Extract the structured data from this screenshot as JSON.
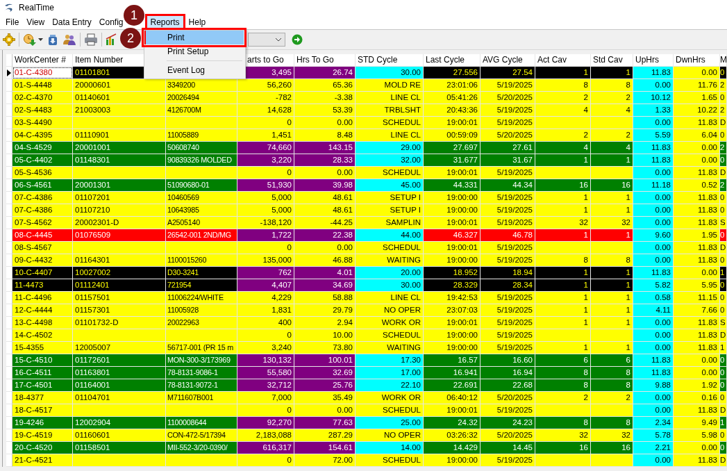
{
  "window": {
    "title": "RealTime"
  },
  "menu_bar": [
    {
      "label": "File",
      "selected": false,
      "annotated": false
    },
    {
      "label": "View",
      "selected": false,
      "annotated": false
    },
    {
      "label": "Data Entry",
      "selected": false,
      "annotated": false
    },
    {
      "label": "Config",
      "selected": false,
      "annotated": false
    },
    {
      "label": "Reports",
      "selected": true,
      "annotated": true
    },
    {
      "label": "Help",
      "selected": false,
      "annotated": false
    }
  ],
  "dropdown_menu": [
    {
      "kind": "item",
      "label": "Print",
      "selected": true,
      "annotated": true
    },
    {
      "kind": "item",
      "label": "Print Setup",
      "selected": false,
      "annotated": false
    },
    {
      "kind": "separator"
    },
    {
      "kind": "item",
      "label": "Event Log",
      "selected": false,
      "annotated": false
    }
  ],
  "callouts": [
    {
      "number": "1"
    },
    {
      "number": "2"
    }
  ],
  "table": {
    "columns": [
      "WorkCenter #",
      "Item Number",
      null,
      "arts to Go",
      "Hrs To Go",
      "STD Cycle",
      "Last Cycle",
      "AVG Cycle",
      "Act Cav",
      "Std Cav",
      "UpHrs",
      "DwnHrs",
      "M"
    ],
    "rows": [
      {
        "color": "#000000",
        "selected": true,
        "cells": [
          "01-C-4380",
          "01101801",
          null,
          "3,495",
          "26.74",
          "30.00",
          "27.556",
          "27.54",
          "1",
          "1",
          "11.83",
          "0.00",
          "0"
        ]
      },
      {
        "color": "#ffff00",
        "selected": false,
        "cells": [
          "01-S-4448",
          "20000601",
          "3349200",
          "56,260",
          "65.36",
          "MOLD RE",
          "23:01:06",
          "5/19/2025",
          "8",
          "8",
          "0.00",
          "11.76",
          "2"
        ]
      },
      {
        "color": "#ffff00",
        "selected": false,
        "cells": [
          "02-C-4370",
          "01140601",
          "20026494",
          "-782",
          "-3.38",
          "LINE CL",
          "05:41:26",
          "5/20/2025",
          "2",
          "2",
          "10.12",
          "1.65",
          "0"
        ]
      },
      {
        "color": "#ffff00",
        "selected": false,
        "cells": [
          "02-S-4483",
          "21003003",
          "4126700M",
          "14,628",
          "53.39",
          "TRBLSHT",
          "20:43:36",
          "5/19/2025",
          "4",
          "4",
          "1.33",
          "10.22",
          "2"
        ]
      },
      {
        "color": "#ffff00",
        "selected": false,
        "cells": [
          "03-S-4490",
          null,
          null,
          "0",
          "0.00",
          "SCHEDUL",
          "19:00:01",
          "5/19/2025",
          null,
          null,
          "0.00",
          "11.83",
          "D"
        ]
      },
      {
        "color": "#ffff00",
        "selected": false,
        "cells": [
          "04-C-4395",
          "01110901",
          "11005889",
          "1,451",
          "8.48",
          "LINE CL",
          "00:59:09",
          "5/20/2025",
          "2",
          "2",
          "5.59",
          "6.04",
          "0"
        ]
      },
      {
        "color": "#008000",
        "selected": false,
        "cells": [
          "04-S-4529",
          "20001001",
          "50608740",
          "74,660",
          "143.15",
          "29.00",
          "27.697",
          "27.61",
          "4",
          "4",
          "11.83",
          "0.00",
          "2"
        ]
      },
      {
        "color": "#008000",
        "selected": false,
        "cells": [
          "05-C-4402",
          "01148301",
          "90839326 MOLDED",
          "3,220",
          "28.33",
          "32.00",
          "31.677",
          "31.67",
          "1",
          "1",
          "11.83",
          "0.00",
          "0"
        ]
      },
      {
        "color": "#ffff00",
        "selected": false,
        "cells": [
          "05-S-4536",
          null,
          null,
          "0",
          "0.00",
          "SCHEDUL",
          "19:00:01",
          "5/19/2025",
          null,
          null,
          "0.00",
          "11.83",
          "D"
        ]
      },
      {
        "color": "#008000",
        "selected": false,
        "cells": [
          "06-S-4561",
          "20001301",
          "51090680-01",
          "51,930",
          "39.98",
          "45.00",
          "44.331",
          "44.34",
          "16",
          "16",
          "11.18",
          "0.52",
          "2"
        ]
      },
      {
        "color": "#ffff00",
        "selected": false,
        "cells": [
          "07-C-4386",
          "01107201",
          "10460569",
          "5,000",
          "48.61",
          "SETUP I",
          "19:00:00",
          "5/19/2025",
          "1",
          "1",
          "0.00",
          "11.83",
          "0"
        ]
      },
      {
        "color": "#ffff00",
        "selected": false,
        "cells": [
          "07-C-4386",
          "01107210",
          "10643985",
          "5,000",
          "48.61",
          "SETUP I",
          "19:00:00",
          "5/19/2025",
          "1",
          "1",
          "0.00",
          "11.83",
          "0"
        ]
      },
      {
        "color": "#ffff00",
        "selected": false,
        "cells": [
          "07-S-4562",
          "20002301-D",
          "A2505140",
          "-138,120",
          "-44.25",
          "SAMPLIN",
          "19:00:01",
          "5/19/2025",
          "32",
          "32",
          "0.00",
          "11.83",
          "S"
        ]
      },
      {
        "color": "#ff0000",
        "selected": false,
        "cells": [
          "08-C-4445",
          "01076509",
          "26542-001 2ND/MG",
          "1,722",
          "22.38",
          "44.00",
          "46.327",
          "46.78",
          "1",
          "1",
          "9.60",
          "1.95",
          "0"
        ]
      },
      {
        "color": "#ffff00",
        "selected": false,
        "cells": [
          "08-S-4567",
          null,
          null,
          "0",
          "0.00",
          "SCHEDUL",
          "19:00:01",
          "5/19/2025",
          null,
          null,
          "0.00",
          "11.83",
          "D"
        ]
      },
      {
        "color": "#ffff00",
        "selected": false,
        "cells": [
          "09-C-4432",
          "01164301",
          "1100015260",
          "135,000",
          "46.88",
          "WAITING",
          "19:00:00",
          "5/19/2025",
          "8",
          "8",
          "0.00",
          "11.83",
          "0"
        ]
      },
      {
        "color": "#000000",
        "selected": false,
        "cells": [
          "10-C-4407",
          "10027002",
          "D30-3241",
          "762",
          "4.01",
          "20.00",
          "18.952",
          "18.94",
          "1",
          "1",
          "11.83",
          "0.00",
          "1"
        ]
      },
      {
        "color": "#000000",
        "selected": false,
        "cells": [
          "11-4473",
          "01112401",
          "721954",
          "4,407",
          "34.69",
          "30.00",
          "28.329",
          "28.34",
          "1",
          "1",
          "5.82",
          "5.95",
          "0"
        ]
      },
      {
        "color": "#ffff00",
        "selected": false,
        "cells": [
          "11-C-4496",
          "01157501",
          "11006224/WHITE",
          "4,229",
          "58.88",
          "LINE CL",
          "19:42:53",
          "5/19/2025",
          "1",
          "1",
          "0.58",
          "11.15",
          "0"
        ]
      },
      {
        "color": "#ffff00",
        "selected": false,
        "cells": [
          "12-C-4444",
          "01157301",
          "11005928",
          "1,831",
          "29.79",
          "NO OPER",
          "23:07:03",
          "5/19/2025",
          "1",
          "1",
          "4.11",
          "7.66",
          "0"
        ]
      },
      {
        "color": "#ffff00",
        "selected": false,
        "cells": [
          "13-C-4498",
          "01101732-D",
          "20022963",
          "400",
          "2.94",
          "WORK OR",
          "19:00:01",
          "5/19/2025",
          "1",
          "1",
          "0.00",
          "11.83",
          "S"
        ]
      },
      {
        "color": "#ffff00",
        "selected": false,
        "cells": [
          "14-C-4502",
          null,
          null,
          "0",
          "10.00",
          "SCHEDUL",
          "19:00:00",
          "5/19/2025",
          null,
          null,
          "0.00",
          "11.83",
          "D"
        ]
      },
      {
        "color": "#ffff00",
        "selected": false,
        "cells": [
          "15-4355",
          "12005007",
          "56717-001 (PR 15 m",
          "3,240",
          "73.80",
          "WAITING",
          "19:00:00",
          "5/19/2025",
          "1",
          "1",
          "0.00",
          "11.83",
          "1"
        ]
      },
      {
        "color": "#008000",
        "selected": false,
        "cells": [
          "15-C-4510",
          "01172601",
          "MON-300-3/173969",
          "130,132",
          "100.01",
          "17.30",
          "16.57",
          "16.60",
          "6",
          "6",
          "11.83",
          "0.00",
          "0"
        ]
      },
      {
        "color": "#008000",
        "selected": false,
        "cells": [
          "16-C-4511",
          "01163801",
          "78-8131-9086-1",
          "55,580",
          "32.69",
          "17.00",
          "16.941",
          "16.94",
          "8",
          "8",
          "11.83",
          "0.00",
          "0"
        ]
      },
      {
        "color": "#008000",
        "selected": false,
        "cells": [
          "17-C-4501",
          "01164001",
          "78-8131-9072-1",
          "32,712",
          "25.76",
          "22.10",
          "22.691",
          "22.68",
          "8",
          "8",
          "9.88",
          "1.92",
          "0"
        ]
      },
      {
        "color": "#ffff00",
        "selected": false,
        "cells": [
          "18-4377",
          "01104701",
          "M711607B001",
          "7,000",
          "35.49",
          "WORK OR",
          "06:40:12",
          "5/20/2025",
          "2",
          "2",
          "0.00",
          "0.16",
          "0"
        ]
      },
      {
        "color": "#ffff00",
        "selected": false,
        "cells": [
          "18-C-4517",
          null,
          null,
          "0",
          "0.00",
          "SCHEDUL",
          "19:00:01",
          "5/19/2025",
          null,
          null,
          "0.00",
          "11.83",
          "D"
        ]
      },
      {
        "color": "#008000",
        "selected": false,
        "cells": [
          "19-4246",
          "12002904",
          "1100008644",
          "92,270",
          "77.63",
          "25.00",
          "24.32",
          "24.23",
          "8",
          "8",
          "2.34",
          "9.49",
          "1"
        ]
      },
      {
        "color": "#ffff00",
        "selected": false,
        "cells": [
          "19-C-4519",
          "01160601",
          "CON-472-5/17394",
          "2,183,088",
          "287.29",
          "NO OPER",
          "03:26:32",
          "5/20/2025",
          "32",
          "32",
          "5.78",
          "5.98",
          "0"
        ]
      },
      {
        "color": "#008000",
        "selected": false,
        "cells": [
          "20-C-4520",
          "01158501",
          "MII-552-3/20-0390/",
          "616,317",
          "154.61",
          "14.00",
          "14.429",
          "14.45",
          "16",
          "16",
          "2.21",
          "0.00",
          "0"
        ]
      },
      {
        "color": "#ffff00",
        "selected": false,
        "cells": [
          "21-C-4521",
          null,
          null,
          "0",
          "72.00",
          "SCHEDUL",
          "19:00:00",
          "5/19/2025",
          null,
          null,
          "0.00",
          "11.83",
          "D"
        ]
      }
    ]
  }
}
